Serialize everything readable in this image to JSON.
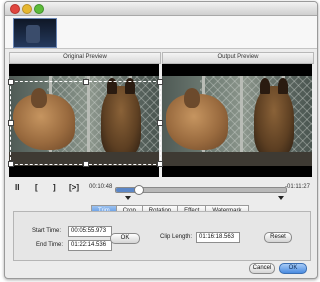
{
  "thumbnails": [
    "video-clip-thumbnail"
  ],
  "preview": {
    "original_title": "Original Preview",
    "output_title": "Output Preview"
  },
  "playback": {
    "buttons": [
      "II",
      "[",
      "]",
      "[>]"
    ],
    "current_time": "00:10:48",
    "end_time": "-01:11:27",
    "progress": 0.13,
    "trim_start_fraction": 0.07,
    "trim_end_fraction": 0.97
  },
  "tabs": {
    "items": [
      "Trim",
      "Crop",
      "Rotation",
      "Effect",
      "Watermark"
    ],
    "active": "Trim"
  },
  "trim": {
    "start_label": "Start Time:",
    "start_value": "00:05:55.973",
    "end_label": "End Time:",
    "end_value": "01:22:14.536",
    "ok_label": "OK",
    "clip_label": "Clip Length:",
    "clip_value": "01:16:18.563",
    "reset_label": "Reset"
  },
  "footer": {
    "cancel_label": "Cancel",
    "ok_label": "OK"
  }
}
